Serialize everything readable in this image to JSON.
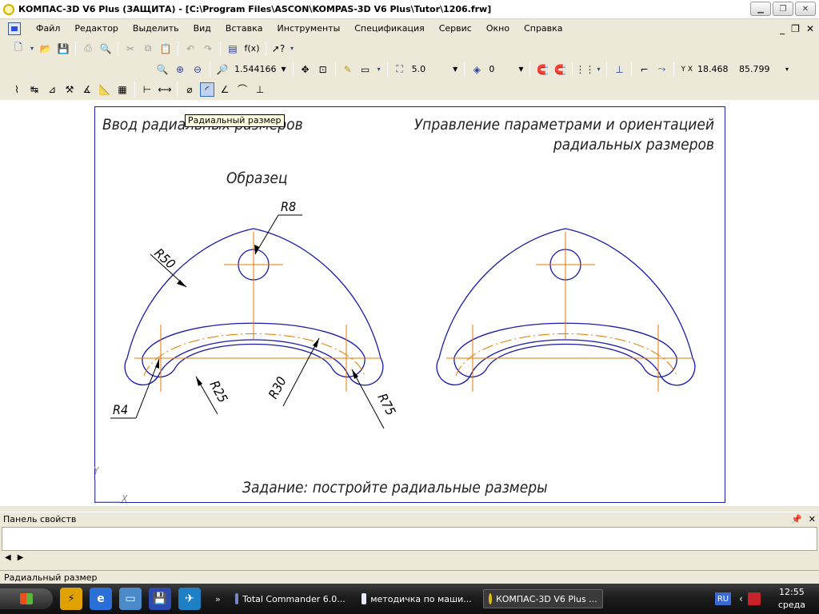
{
  "window": {
    "title": "КОМПАС-3D V6 Plus (ЗАЩИТА) - [C:\\Program Files\\ASCON\\KOMPAS-3D V6 Plus\\Tutor\\1206.frw]"
  },
  "menu": [
    "Файл",
    "Редактор",
    "Выделить",
    "Вид",
    "Вставка",
    "Инструменты",
    "Спецификация",
    "Сервис",
    "Окно",
    "Справка"
  ],
  "toolbar": {
    "fx_label": "f(x)",
    "zoom": "1.544166",
    "step": "5.0",
    "layer": "0",
    "coord_label": "Y X",
    "coord_x": "18.468",
    "coord_y": "85.799"
  },
  "tooltip": "Радиальный размер",
  "drawing": {
    "title_left": "Ввод радиальных размеров",
    "title_right_1": "Управление параметрами и ориентацией",
    "title_right_2": "радиальных размеров",
    "sample_label": "Образец",
    "dims": [
      "R8",
      "R50",
      "R4",
      "R25",
      "R30",
      "R75"
    ],
    "task": "Задание: постройте радиальные размеры",
    "axis_y": "Y",
    "axis_x": "X"
  },
  "panel": {
    "title": "Панель свойств"
  },
  "status": "Радиальный размер",
  "taskbar": {
    "tasks": [
      "Total Commander 6.0...",
      "методичка по маши...",
      "КОМПАС-3D V6 Plus ..."
    ],
    "lang": "RU",
    "time": "12:55",
    "day": "среда"
  },
  "colors": {
    "contour": "#1a1aa8",
    "axis": "#e07800",
    "frame": "#1a1aa8"
  }
}
